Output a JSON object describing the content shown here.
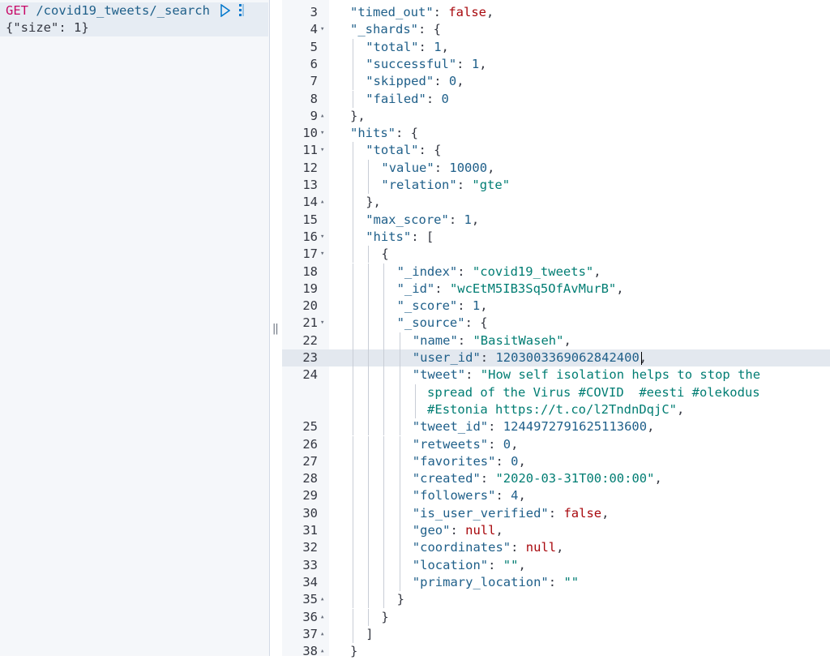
{
  "request": {
    "method": "GET",
    "path": "/covid19_tweets/_search",
    "body": "{\"size\": 1}"
  },
  "response_lines": [
    {
      "n": "3",
      "fold": "",
      "d": 1,
      "t": [
        [
          "\"timed_out\"",
          "k"
        ],
        [
          ": ",
          "p"
        ],
        [
          "false",
          "kw"
        ],
        [
          ",",
          "p"
        ]
      ]
    },
    {
      "n": "4",
      "fold": "▾",
      "d": 1,
      "t": [
        [
          "\"_shards\"",
          "k"
        ],
        [
          ": {",
          "p"
        ]
      ]
    },
    {
      "n": "5",
      "fold": "",
      "d": 2,
      "t": [
        [
          "\"total\"",
          "k"
        ],
        [
          ": ",
          "p"
        ],
        [
          "1",
          "n"
        ],
        [
          ",",
          "p"
        ]
      ]
    },
    {
      "n": "6",
      "fold": "",
      "d": 2,
      "t": [
        [
          "\"successful\"",
          "k"
        ],
        [
          ": ",
          "p"
        ],
        [
          "1",
          "n"
        ],
        [
          ",",
          "p"
        ]
      ]
    },
    {
      "n": "7",
      "fold": "",
      "d": 2,
      "t": [
        [
          "\"skipped\"",
          "k"
        ],
        [
          ": ",
          "p"
        ],
        [
          "0",
          "n"
        ],
        [
          ",",
          "p"
        ]
      ]
    },
    {
      "n": "8",
      "fold": "",
      "d": 2,
      "t": [
        [
          "\"failed\"",
          "k"
        ],
        [
          ": ",
          "p"
        ],
        [
          "0",
          "n"
        ]
      ]
    },
    {
      "n": "9",
      "fold": "▴",
      "d": 1,
      "t": [
        [
          "},",
          "p"
        ]
      ]
    },
    {
      "n": "10",
      "fold": "▾",
      "d": 1,
      "t": [
        [
          "\"hits\"",
          "k"
        ],
        [
          ": {",
          "p"
        ]
      ]
    },
    {
      "n": "11",
      "fold": "▾",
      "d": 2,
      "t": [
        [
          "\"total\"",
          "k"
        ],
        [
          ": {",
          "p"
        ]
      ]
    },
    {
      "n": "12",
      "fold": "",
      "d": 3,
      "t": [
        [
          "\"value\"",
          "k"
        ],
        [
          ": ",
          "p"
        ],
        [
          "10000",
          "n"
        ],
        [
          ",",
          "p"
        ]
      ]
    },
    {
      "n": "13",
      "fold": "",
      "d": 3,
      "t": [
        [
          "\"relation\"",
          "k"
        ],
        [
          ": ",
          "p"
        ],
        [
          "\"gte\"",
          "s"
        ]
      ]
    },
    {
      "n": "14",
      "fold": "▴",
      "d": 2,
      "t": [
        [
          "},",
          "p"
        ]
      ]
    },
    {
      "n": "15",
      "fold": "",
      "d": 2,
      "t": [
        [
          "\"max_score\"",
          "k"
        ],
        [
          ": ",
          "p"
        ],
        [
          "1",
          "n"
        ],
        [
          ",",
          "p"
        ]
      ]
    },
    {
      "n": "16",
      "fold": "▾",
      "d": 2,
      "t": [
        [
          "\"hits\"",
          "k"
        ],
        [
          ": [",
          "p"
        ]
      ]
    },
    {
      "n": "17",
      "fold": "▾",
      "d": 3,
      "t": [
        [
          "{",
          "p"
        ]
      ]
    },
    {
      "n": "18",
      "fold": "",
      "d": 4,
      "t": [
        [
          "\"_index\"",
          "k"
        ],
        [
          ": ",
          "p"
        ],
        [
          "\"covid19_tweets\"",
          "s"
        ],
        [
          ",",
          "p"
        ]
      ]
    },
    {
      "n": "19",
      "fold": "",
      "d": 4,
      "t": [
        [
          "\"_id\"",
          "k"
        ],
        [
          ": ",
          "p"
        ],
        [
          "\"wcEtM5IB3Sq5OfAvMurB\"",
          "s"
        ],
        [
          ",",
          "p"
        ]
      ]
    },
    {
      "n": "20",
      "fold": "",
      "d": 4,
      "t": [
        [
          "\"_score\"",
          "k"
        ],
        [
          ": ",
          "p"
        ],
        [
          "1",
          "n"
        ],
        [
          ",",
          "p"
        ]
      ]
    },
    {
      "n": "21",
      "fold": "▾",
      "d": 4,
      "t": [
        [
          "\"_source\"",
          "k"
        ],
        [
          ": {",
          "p"
        ]
      ]
    },
    {
      "n": "22",
      "fold": "",
      "d": 5,
      "t": [
        [
          "\"name\"",
          "k"
        ],
        [
          ": ",
          "p"
        ],
        [
          "\"BasitWaseh\"",
          "s"
        ],
        [
          ",",
          "p"
        ]
      ]
    },
    {
      "n": "23",
      "fold": "",
      "d": 5,
      "active": true,
      "t": [
        [
          "\"user_id\"",
          "k"
        ],
        [
          ": ",
          "p"
        ],
        [
          "1203003369062842400",
          "n"
        ],
        [
          ",",
          "p"
        ]
      ]
    },
    {
      "n": "24",
      "fold": "",
      "d": 5,
      "t": [
        [
          "\"tweet\"",
          "k"
        ],
        [
          ": ",
          "p"
        ],
        [
          "\"How self isolation helps to stop the",
          "s"
        ]
      ]
    },
    {
      "n": "",
      "fold": "",
      "d": 0,
      "indent": "        ",
      "t": [
        [
          "spread of the Virus #COVID  #eesti #olekodus",
          "s"
        ]
      ]
    },
    {
      "n": "",
      "fold": "",
      "d": 0,
      "indent": "        ",
      "t": [
        [
          "#Estonia https://t.co/l2TndnDqjC\"",
          "s"
        ],
        [
          ",",
          "p"
        ]
      ]
    },
    {
      "n": "25",
      "fold": "",
      "d": 5,
      "t": [
        [
          "\"tweet_id\"",
          "k"
        ],
        [
          ": ",
          "p"
        ],
        [
          "1244972791625113600",
          "n"
        ],
        [
          ",",
          "p"
        ]
      ]
    },
    {
      "n": "26",
      "fold": "",
      "d": 5,
      "t": [
        [
          "\"retweets\"",
          "k"
        ],
        [
          ": ",
          "p"
        ],
        [
          "0",
          "n"
        ],
        [
          ",",
          "p"
        ]
      ]
    },
    {
      "n": "27",
      "fold": "",
      "d": 5,
      "t": [
        [
          "\"favorites\"",
          "k"
        ],
        [
          ": ",
          "p"
        ],
        [
          "0",
          "n"
        ],
        [
          ",",
          "p"
        ]
      ]
    },
    {
      "n": "28",
      "fold": "",
      "d": 5,
      "t": [
        [
          "\"created\"",
          "k"
        ],
        [
          ": ",
          "p"
        ],
        [
          "\"2020-03-31T00:00:00\"",
          "s"
        ],
        [
          ",",
          "p"
        ]
      ]
    },
    {
      "n": "29",
      "fold": "",
      "d": 5,
      "t": [
        [
          "\"followers\"",
          "k"
        ],
        [
          ": ",
          "p"
        ],
        [
          "4",
          "n"
        ],
        [
          ",",
          "p"
        ]
      ]
    },
    {
      "n": "30",
      "fold": "",
      "d": 5,
      "t": [
        [
          "\"is_user_verified\"",
          "k"
        ],
        [
          ": ",
          "p"
        ],
        [
          "false",
          "kw"
        ],
        [
          ",",
          "p"
        ]
      ]
    },
    {
      "n": "31",
      "fold": "",
      "d": 5,
      "t": [
        [
          "\"geo\"",
          "k"
        ],
        [
          ": ",
          "p"
        ],
        [
          "null",
          "kw"
        ],
        [
          ",",
          "p"
        ]
      ]
    },
    {
      "n": "32",
      "fold": "",
      "d": 5,
      "t": [
        [
          "\"coordinates\"",
          "k"
        ],
        [
          ": ",
          "p"
        ],
        [
          "null",
          "kw"
        ],
        [
          ",",
          "p"
        ]
      ]
    },
    {
      "n": "33",
      "fold": "",
      "d": 5,
      "t": [
        [
          "\"location\"",
          "k"
        ],
        [
          ": ",
          "p"
        ],
        [
          "\"\"",
          "s"
        ],
        [
          ",",
          "p"
        ]
      ]
    },
    {
      "n": "34",
      "fold": "",
      "d": 5,
      "t": [
        [
          "\"primary_location\"",
          "k"
        ],
        [
          ": ",
          "p"
        ],
        [
          "\"\"",
          "s"
        ]
      ]
    },
    {
      "n": "35",
      "fold": "▴",
      "d": 4,
      "t": [
        [
          "}",
          "p"
        ]
      ]
    },
    {
      "n": "36",
      "fold": "▴",
      "d": 3,
      "t": [
        [
          "}",
          "p"
        ]
      ]
    },
    {
      "n": "37",
      "fold": "▴",
      "d": 2,
      "t": [
        [
          "]",
          "p"
        ]
      ]
    },
    {
      "n": "38",
      "fold": "▴",
      "d": 1,
      "t": [
        [
          "}",
          "p"
        ]
      ]
    }
  ]
}
